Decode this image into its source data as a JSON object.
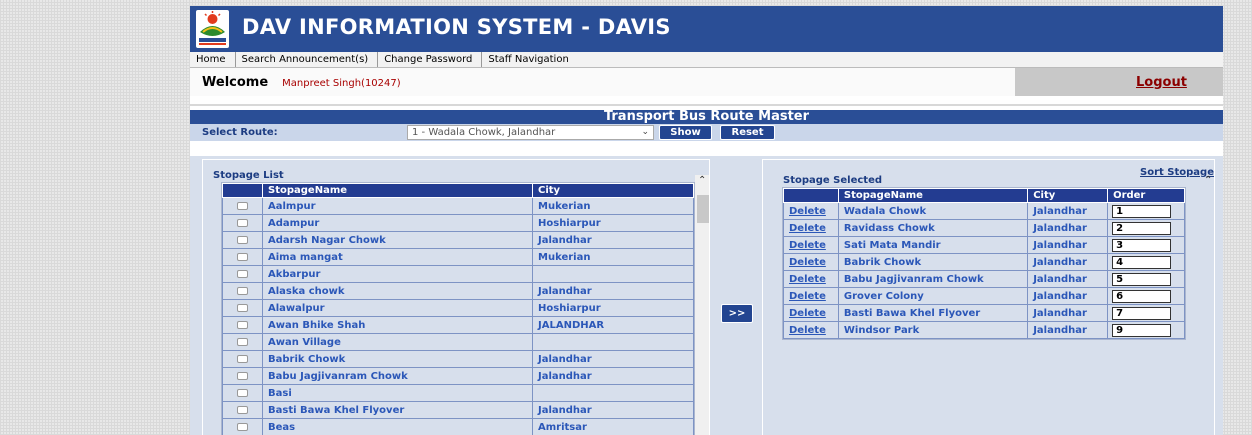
{
  "header": {
    "title": "DAV INFORMATION SYSTEM - DAVIS",
    "colors": {
      "brand": "#2a4e96",
      "accent_red": "#a80000"
    }
  },
  "menu": [
    "Home",
    "Search Announcement(s)",
    "Change Password",
    "Staff Navigation"
  ],
  "welcome": {
    "label": "Welcome",
    "user": "Manpreet Singh(10247)",
    "logout": "Logout"
  },
  "page_title": "Transport Bus Route Master",
  "route": {
    "label": "Select Route:",
    "selected": "1 - Wadala Chowk, Jalandhar",
    "show": "Show",
    "reset": "Reset"
  },
  "stopage_list": {
    "legend": "Stopage List",
    "columns": [
      "",
      "StopageName",
      "City"
    ],
    "rows": [
      {
        "name": "Aalmpur",
        "city": "Mukerian"
      },
      {
        "name": "Adampur",
        "city": "Hoshiarpur"
      },
      {
        "name": "Adarsh Nagar Chowk",
        "city": "Jalandhar"
      },
      {
        "name": "Aima mangat",
        "city": "Mukerian"
      },
      {
        "name": "Akbarpur",
        "city": ""
      },
      {
        "name": "Alaska chowk",
        "city": "Jalandhar"
      },
      {
        "name": "Alawalpur",
        "city": "Hoshiarpur"
      },
      {
        "name": "Awan Bhike Shah",
        "city": "JALANDHAR"
      },
      {
        "name": "Awan Village",
        "city": ""
      },
      {
        "name": "Babrik Chowk",
        "city": "Jalandhar"
      },
      {
        "name": "Babu Jagjivanram Chowk",
        "city": "Jalandhar"
      },
      {
        "name": "Basi",
        "city": ""
      },
      {
        "name": "Basti Bawa Khel Flyover",
        "city": "Jalandhar"
      },
      {
        "name": "Beas",
        "city": "Amritsar"
      }
    ]
  },
  "move_button": ">>",
  "stopage_selected": {
    "legend": "Stopage Selected",
    "sort_link": "Sort Stopage",
    "columns": [
      "",
      "StopageName",
      "City",
      "Order"
    ],
    "delete_label": "Delete",
    "rows": [
      {
        "name": "Wadala Chowk",
        "city": "Jalandhar",
        "order": "1"
      },
      {
        "name": "Ravidass Chowk",
        "city": "Jalandhar",
        "order": "2"
      },
      {
        "name": "Sati Mata Mandir",
        "city": "Jalandhar",
        "order": "3"
      },
      {
        "name": "Babrik Chowk",
        "city": "Jalandhar",
        "order": "4"
      },
      {
        "name": "Babu Jagjivanram Chowk",
        "city": "Jalandhar",
        "order": "5"
      },
      {
        "name": "Grover Colony",
        "city": "Jalandhar",
        "order": "6"
      },
      {
        "name": "Basti Bawa Khel Flyover",
        "city": "Jalandhar",
        "order": "7"
      },
      {
        "name": "Windsor Park",
        "city": "Jalandhar",
        "order": "9"
      }
    ]
  }
}
